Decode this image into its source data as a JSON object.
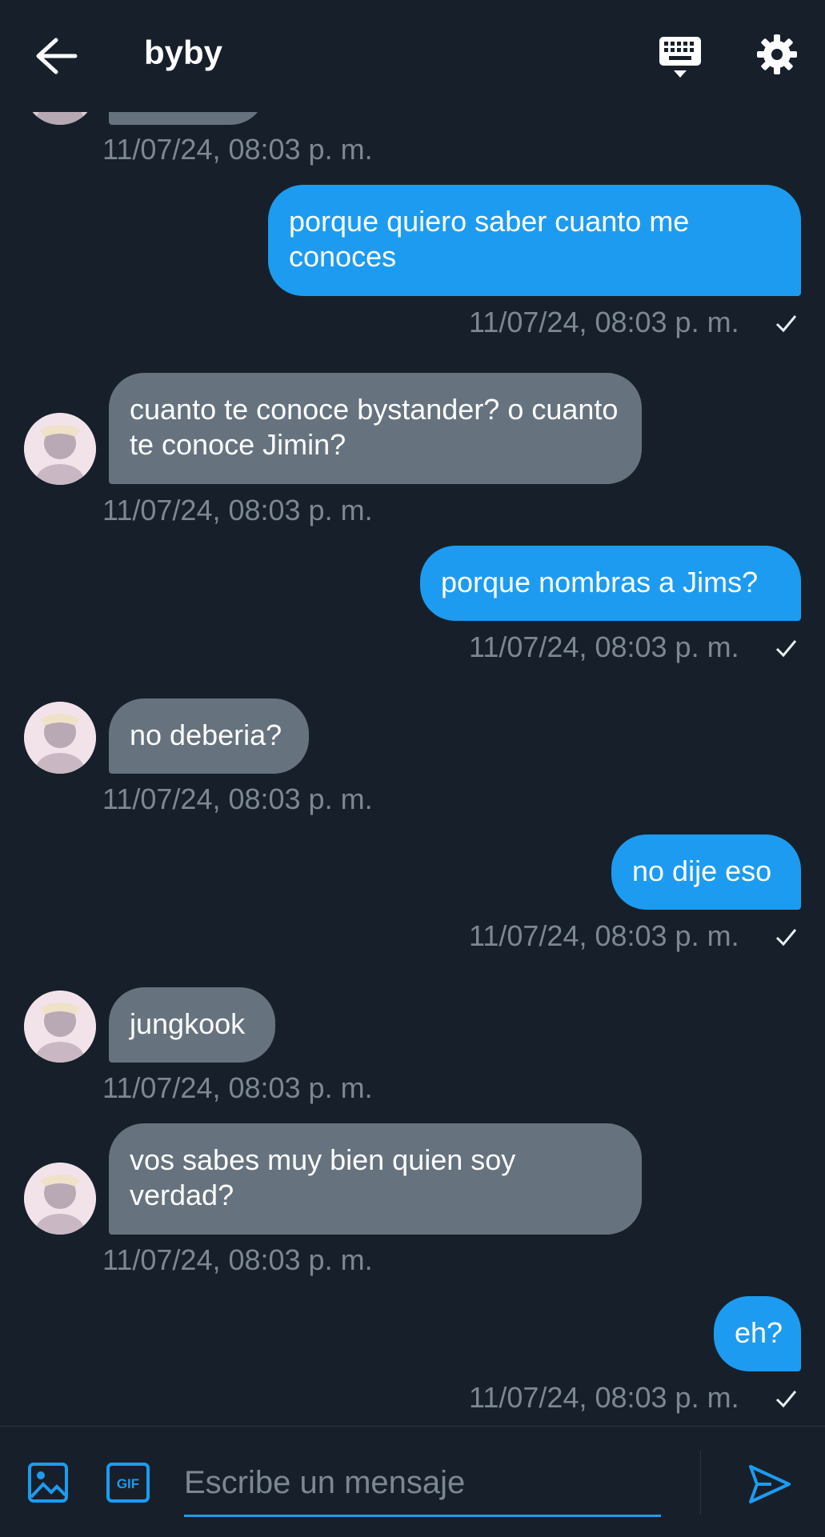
{
  "header": {
    "title": "byby",
    "back_icon": "arrow-left-icon",
    "keyboard_icon": "keyboard-icon",
    "settings_icon": "gear-icon"
  },
  "colors": {
    "background": "#17202a",
    "outgoing_bubble": "#1d9bf0",
    "incoming_bubble": "#66737f",
    "timestamp": "#7c8792"
  },
  "messages": [
    {
      "direction": "in",
      "text": "",
      "time": "11/07/24, 08:03 p. m."
    },
    {
      "direction": "out",
      "text": "porque quiero saber cuanto me conoces",
      "time": "11/07/24, 08:03 p. m.",
      "status": "sent"
    },
    {
      "direction": "in",
      "text": "cuanto te conoce bystander? o cuanto te conoce Jimin?",
      "time": "11/07/24, 08:03 p. m."
    },
    {
      "direction": "out",
      "text": "porque nombras a Jims?",
      "time": "11/07/24, 08:03 p. m.",
      "status": "sent"
    },
    {
      "direction": "in",
      "text": "no deberia?",
      "time": "11/07/24, 08:03 p. m."
    },
    {
      "direction": "out",
      "text": "no dije eso",
      "time": "11/07/24, 08:03 p. m.",
      "status": "sent"
    },
    {
      "direction": "in",
      "text": "jungkook",
      "time": "11/07/24, 08:03 p. m."
    },
    {
      "direction": "in",
      "text": "vos sabes muy bien quien soy verdad?",
      "time": "11/07/24, 08:03 p. m."
    },
    {
      "direction": "out",
      "text": "eh?",
      "time": "11/07/24, 08:03 p. m.",
      "status": "sent"
    }
  ],
  "composer": {
    "placeholder": "Escribe un mensaje",
    "value": "",
    "image_icon": "image-icon",
    "gif_icon": "gif-icon",
    "send_icon": "send-icon"
  }
}
